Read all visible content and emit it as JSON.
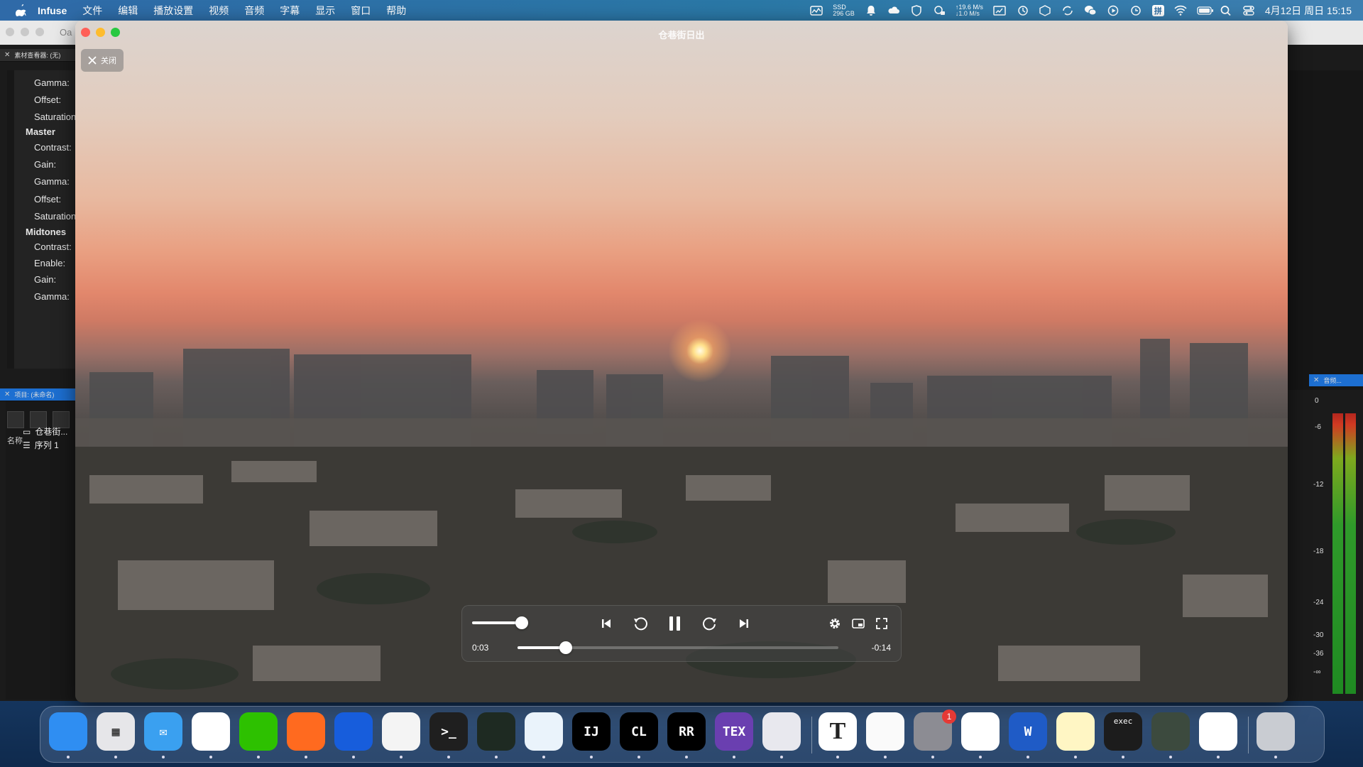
{
  "menubar": {
    "app_name": "Infuse",
    "items": [
      "文件",
      "编辑",
      "播放设置",
      "视频",
      "音频",
      "字幕",
      "显示",
      "窗口",
      "帮助"
    ],
    "ssd_label": "SSD",
    "ssd_free": "296 GB",
    "net_up": "↑19.6 M/s",
    "net_down": "↓1.0 M/s",
    "input_method": "拼",
    "datetime": "4月12日 周日 15:15"
  },
  "background_app": {
    "title_fragment": "Oa",
    "viewer_panel_title": "素材查看器: (无)",
    "properties": [
      {
        "label": "Gamma:",
        "group": false
      },
      {
        "label": "Offset:",
        "group": false
      },
      {
        "label": "Saturation",
        "group": false
      },
      {
        "label": "Master",
        "group": true
      },
      {
        "label": "Contrast:",
        "group": false
      },
      {
        "label": "Gain:",
        "group": false
      },
      {
        "label": "Gamma:",
        "group": false
      },
      {
        "label": "Offset:",
        "group": false
      },
      {
        "label": "Saturation",
        "group": false
      },
      {
        "label": "Midtones",
        "group": true
      },
      {
        "label": "Contrast:",
        "group": false
      },
      {
        "label": "Enable:",
        "group": false
      },
      {
        "label": "Gain:",
        "group": false
      },
      {
        "label": "Gamma:",
        "group": false
      }
    ],
    "project_panel_title": "项目: (未命名)",
    "project_column": "名称",
    "project_items": [
      "仓巷街...",
      "序列 1"
    ],
    "audio_panel_title": "音频...",
    "meter_scale": [
      "0",
      "-6",
      "-12",
      "-18",
      "-24",
      "-30",
      "-36",
      "-∞"
    ]
  },
  "player": {
    "window_title": "仓巷街日出",
    "close_label": "关闭",
    "time_elapsed": "0:03",
    "time_remaining": "-0:14",
    "progress_fraction": 0.15,
    "volume_fraction": 0.75,
    "icons": [
      "skip-back-icon",
      "rewind-icon",
      "pause-icon",
      "forward-icon",
      "skip-forward-icon",
      "gear-icon",
      "pip-icon",
      "fullscreen-icon"
    ]
  },
  "dock": {
    "apps": [
      {
        "name": "finder",
        "glyph": "",
        "color": "#2f8ef2"
      },
      {
        "name": "launchpad",
        "glyph": "▦",
        "color": "#e6e6e9"
      },
      {
        "name": "mail",
        "glyph": "✉",
        "color": "#3aa0f0"
      },
      {
        "name": "qq",
        "glyph": "",
        "color": "#ffffff"
      },
      {
        "name": "wechat",
        "glyph": "",
        "color": "#2dc100"
      },
      {
        "name": "firefox",
        "glyph": "",
        "color": "#ff6a1f"
      },
      {
        "name": "bitwarden",
        "glyph": "",
        "color": "#175ddc"
      },
      {
        "name": "chatgpt",
        "glyph": "",
        "color": "#f4f4f4"
      },
      {
        "name": "terminal",
        "glyph": ">_",
        "color": "#1f1f1f"
      },
      {
        "name": "activity-monitor",
        "glyph": "",
        "color": "#1e2a22"
      },
      {
        "name": "network-browser",
        "glyph": "",
        "color": "#eaf3fb"
      },
      {
        "name": "intellij",
        "glyph": "IJ",
        "color": "#000000"
      },
      {
        "name": "clion",
        "glyph": "CL",
        "color": "#000000"
      },
      {
        "name": "rustrover",
        "glyph": "RR",
        "color": "#000000"
      },
      {
        "name": "texshop",
        "glyph": "TEX",
        "color": "#6a3fb0"
      },
      {
        "name": "remote-desktop",
        "glyph": "",
        "color": "#e8e8ee"
      },
      {
        "name": "typora",
        "glyph": "T",
        "color": "#ffffff"
      },
      {
        "name": "notebook",
        "glyph": "",
        "color": "#fafafa"
      },
      {
        "name": "system-settings",
        "glyph": "",
        "color": "#8c8c93",
        "badge": "1"
      },
      {
        "name": "feishu",
        "glyph": "",
        "color": "#ffffff"
      },
      {
        "name": "word",
        "glyph": "W",
        "color": "#1f5bc6"
      },
      {
        "name": "notes",
        "glyph": "",
        "color": "#fff6c4"
      },
      {
        "name": "exec",
        "glyph": "exec",
        "color": "#1c1c1c"
      },
      {
        "name": "reeder",
        "glyph": "",
        "color": "#3c4a3e"
      },
      {
        "name": "infuse",
        "glyph": "",
        "color": "#ffffff"
      },
      {
        "name": "trash",
        "glyph": "",
        "color": "#c9ccd2"
      }
    ]
  }
}
